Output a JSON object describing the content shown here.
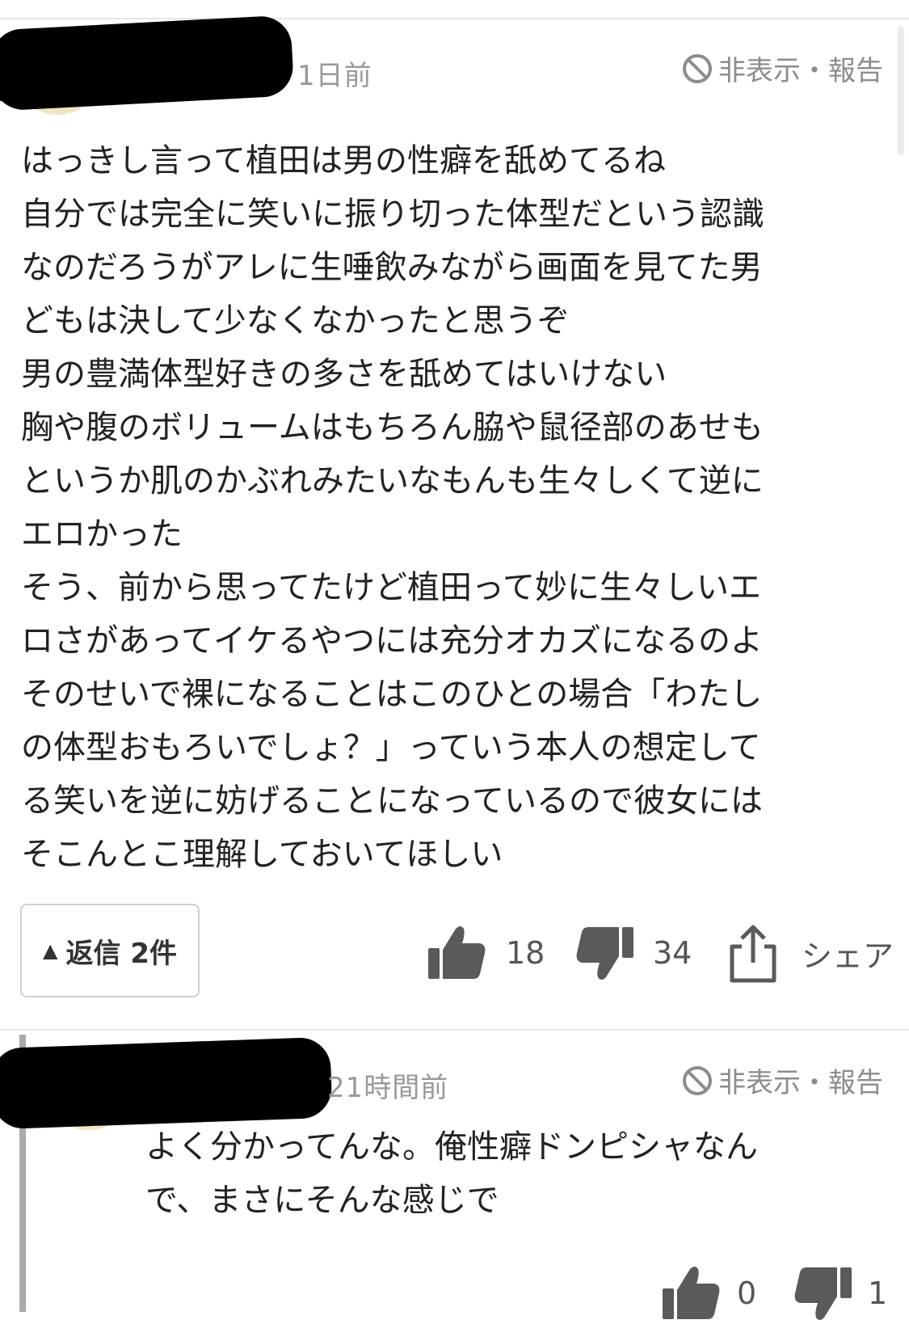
{
  "comment": {
    "time": "1日前",
    "hide_report": "非表示・報告",
    "text": "はっきし言って植田は男の性癖を舐めてるね\n自分では完全に笑いに振り切った体型だという認識\nなのだろうがアレに生唾飲みながら画面を見てた男\nどもは決して少なくなかったと思うぞ\n男の豊満体型好きの多さを舐めてはいけない\n胸や腹のボリュームはもちろん脇や鼠径部のあせも\nというか肌のかぶれみたいなもんも生々しくて逆に\nエロかった\nそう、前から思ってたけど植田って妙に生々しいエ\nロさがあってイケるやつには充分オカズになるのよ\nそのせいで裸になることはこのひとの場合「わたし\nの体型おもろいでしょ？」っていう本人の想定して\nる笑いを逆に妨げることになっているので彼女には\nそこんとこ理解しておいてほしい",
    "reply_label": "返信 2件",
    "likes": "18",
    "dislikes": "34",
    "share_label": "シェア"
  },
  "reply": {
    "time": "21時間前",
    "hide_report": "非表示・報告",
    "text": "よく分かってんな。俺性癖ドンピシャなん\nで、まさにそんな感じで",
    "likes": "0",
    "dislikes": "1"
  },
  "icons": {
    "hide": "block-icon",
    "like": "thumbs-up-icon",
    "dislike": "thumbs-down-icon",
    "share": "share-icon",
    "reply_toggle": "triangle-up-icon"
  },
  "colors": {
    "icon_gray": "#5a5a5a",
    "meta_gray": "#8c8c8c",
    "text": "#222222"
  }
}
